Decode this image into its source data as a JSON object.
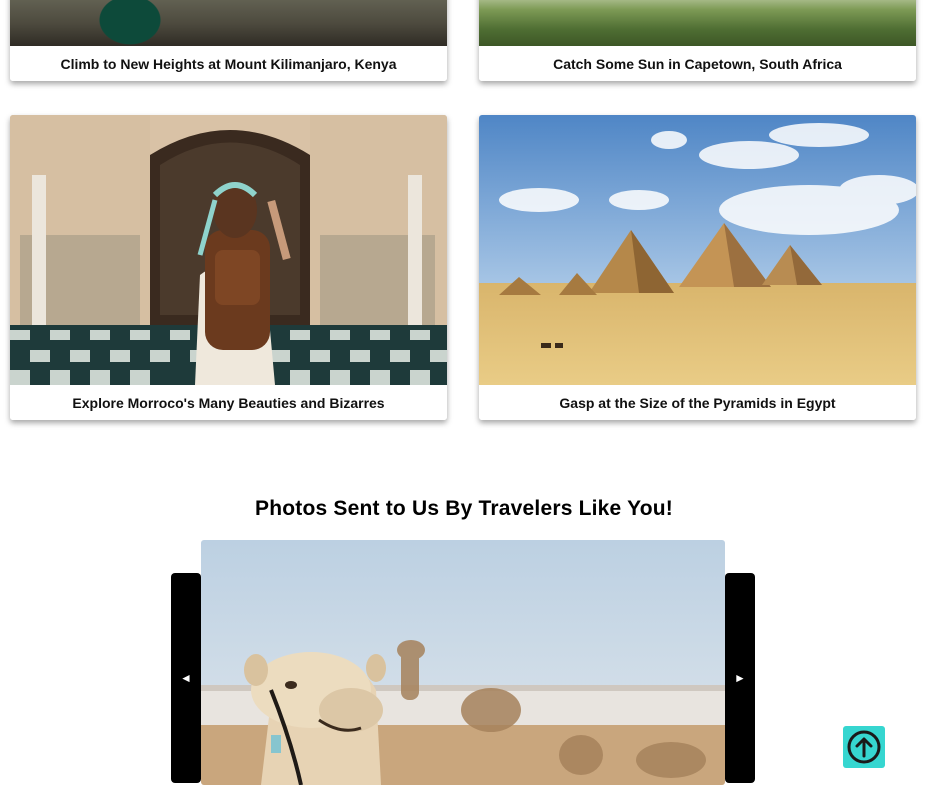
{
  "destinations": [
    {
      "caption": "Climb to New Heights at Mount Kilimanjaro, Kenya"
    },
    {
      "caption": "Catch Some Sun in Capetown, South Africa"
    },
    {
      "caption": "Explore Morroco's Many Beauties and Bizarres"
    },
    {
      "caption": "Gasp at the Size of the Pyramids in Egypt"
    }
  ],
  "gallery": {
    "title": "Photos Sent to Us By Travelers Like You!",
    "prev_glyph": "◄",
    "next_glyph": "►"
  },
  "colors": {
    "back_to_top_bg": "#36d6d0",
    "slider_controls": "#000000"
  },
  "icons": {
    "back_to_top": "arrow-up-circle-icon"
  }
}
